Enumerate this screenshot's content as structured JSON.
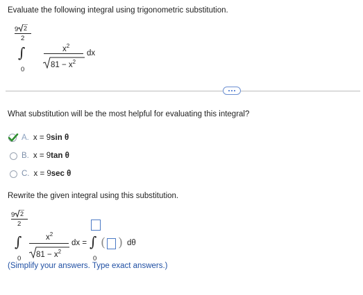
{
  "question": {
    "prompt": "Evaluate the following integral using trigonometric substitution.",
    "integral": {
      "upper_limit": "9√2",
      "upper_limit_num": "9",
      "upper_limit_den": "2",
      "lower_limit": "0",
      "numerator": "x",
      "numerator_exp": "2",
      "denominator": "81 − x",
      "denominator_exp": "2",
      "differential": "dx"
    }
  },
  "more_button_label": "···",
  "part1": {
    "prompt": "What substitution will be the most helpful for evaluating this integral?",
    "choices": [
      {
        "letter": "A.",
        "text": "x = 9 sin θ",
        "lhs": "x = 9 ",
        "fn": "sin θ",
        "correct": true
      },
      {
        "letter": "B.",
        "text": "x = 9 tan θ",
        "lhs": "x = 9 ",
        "fn": "tan θ",
        "correct": false
      },
      {
        "letter": "C.",
        "text": "x = 9 sec θ",
        "lhs": "x = 9 ",
        "fn": "sec θ",
        "correct": false
      }
    ]
  },
  "part2": {
    "prompt": "Rewrite the given integral using this substitution.",
    "integral": {
      "upper_limit_num": "9",
      "upper_limit_den": "2",
      "lower_limit": "0",
      "numerator": "x",
      "numerator_exp": "2",
      "denominator": "81 − x",
      "denominator_exp": "2",
      "differential": "dx =",
      "rhs_lower_limit": "0",
      "rhs_differential": "dθ"
    },
    "upper_limit_box_value": "",
    "integrand_box_value": "",
    "hint": "(Simplify your answers. Type exact answers.)"
  },
  "colors": {
    "accent": "#3366cc",
    "correct": "#2f8f2f",
    "text": "#222222"
  }
}
